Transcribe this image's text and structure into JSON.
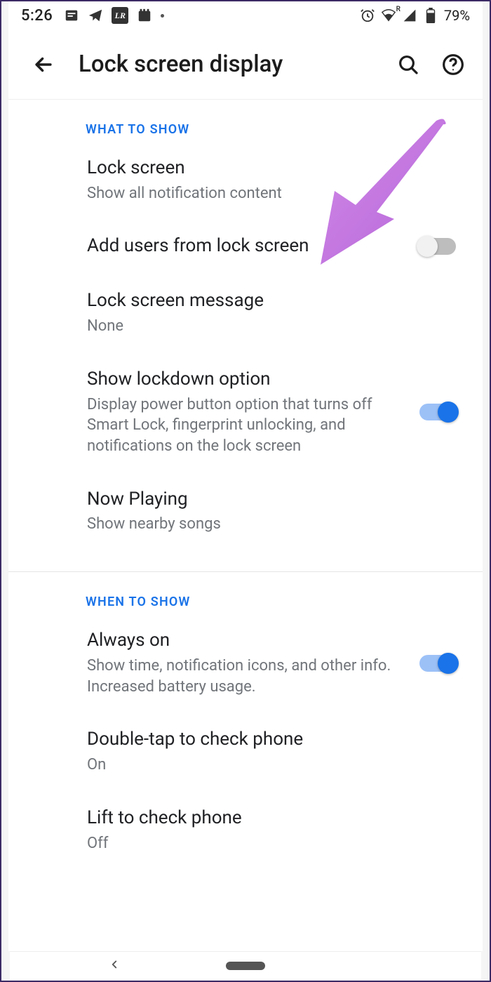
{
  "status": {
    "time": "5:26",
    "battery": "79%",
    "wifi_label": "R"
  },
  "header": {
    "title": "Lock screen display"
  },
  "sections": {
    "what": {
      "label": "WHAT TO SHOW",
      "lock_screen": {
        "title": "Lock screen",
        "sub": "Show all notification content"
      },
      "add_users": {
        "title": "Add users from lock screen"
      },
      "message": {
        "title": "Lock screen message",
        "sub": "None"
      },
      "lockdown": {
        "title": "Show lockdown option",
        "sub": "Display power button option that turns off Smart Lock, fingerprint unlocking, and notifications on the lock screen"
      },
      "now_playing": {
        "title": "Now Playing",
        "sub": "Show nearby songs"
      }
    },
    "when": {
      "label": "WHEN TO SHOW",
      "always_on": {
        "title": "Always on",
        "sub": "Show time, notification icons, and other info. Increased battery usage."
      },
      "double_tap": {
        "title": "Double-tap to check phone",
        "sub": "On"
      },
      "lift": {
        "title": "Lift to check phone",
        "sub": "Off"
      }
    }
  }
}
